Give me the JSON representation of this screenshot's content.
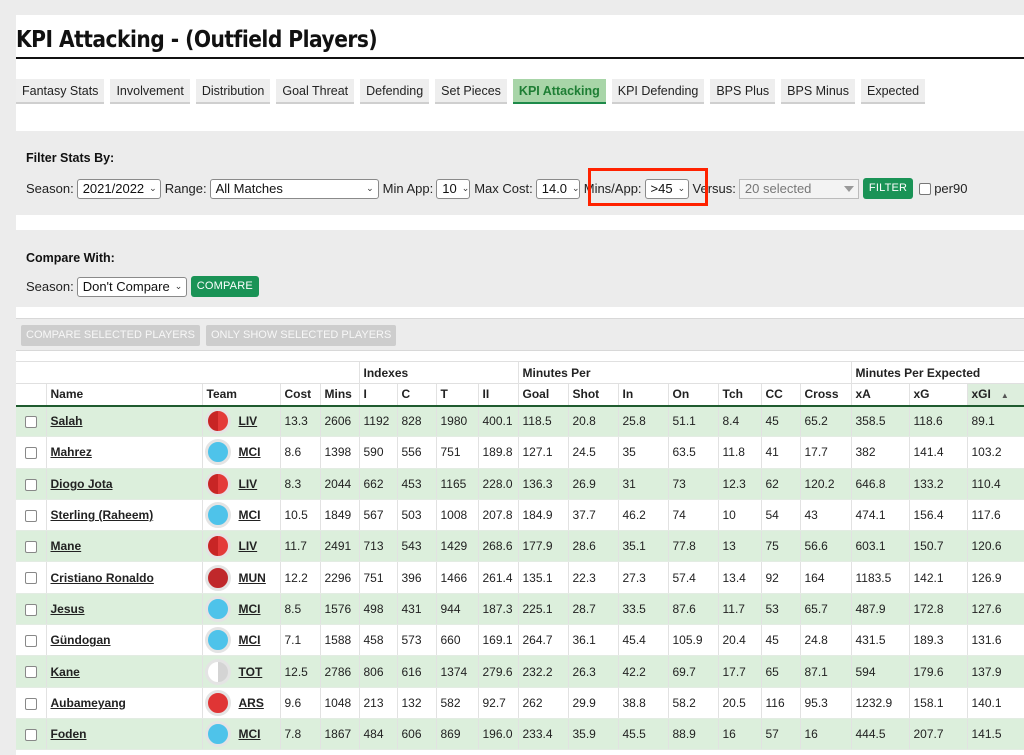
{
  "header": {
    "title": "KPI Attacking - (Outfield Players)"
  },
  "tabs": [
    {
      "label": "Fantasy Stats",
      "active": false
    },
    {
      "label": "Involvement",
      "active": false
    },
    {
      "label": "Distribution",
      "active": false
    },
    {
      "label": "Goal Threat",
      "active": false
    },
    {
      "label": "Defending",
      "active": false
    },
    {
      "label": "Set Pieces",
      "active": false
    },
    {
      "label": "KPI Attacking",
      "active": true
    },
    {
      "label": "KPI Defending",
      "active": false
    },
    {
      "label": "BPS Plus",
      "active": false
    },
    {
      "label": "BPS Minus",
      "active": false
    },
    {
      "label": "Expected",
      "active": false
    }
  ],
  "filter": {
    "title": "Filter Stats By:",
    "season_label": "Season:",
    "season_value": "2021/2022",
    "range_label": "Range:",
    "range_value": "All Matches",
    "min_app_label": "Min App:",
    "min_app_value": "10",
    "max_cost_label": "Max Cost:",
    "max_cost_value": "14.0",
    "mins_app_label": "Mins/App:",
    "mins_app_value": ">45",
    "versus_label": "Versus:",
    "versus_value": "20 selected",
    "filter_button": "FILTER",
    "per90_label": "per90"
  },
  "compare": {
    "title": "Compare With:",
    "season_label": "Season:",
    "season_value": "Don't Compare",
    "compare_button": "COMPARE"
  },
  "actions": {
    "compare_selected": "COMPARE SELECTED PLAYERS",
    "only_show_selected": "ONLY SHOW SELECTED PLAYERS"
  },
  "table": {
    "groups": {
      "indexes": "Indexes",
      "minutes_per": "Minutes Per",
      "minutes_per_expected": "Minutes Per Expected"
    },
    "columns": [
      "Name",
      "Team",
      "Cost",
      "Mins",
      "I",
      "C",
      "T",
      "II",
      "Goal",
      "Shot",
      "In",
      "On",
      "Tch",
      "CC",
      "Cross",
      "xA",
      "xG",
      "xGI"
    ],
    "sort_indicator": "▲",
    "team_colors": {
      "LIV": "#d42d2d",
      "MCI": "#4ec3ea",
      "MUN": "#c0282b",
      "TOT": "#ffffff",
      "ARS": "#e03535"
    },
    "rows": [
      {
        "name": "Salah",
        "team": "LIV",
        "cost": "13.3",
        "mins": "2606",
        "i": "1192",
        "c": "828",
        "t": "1980",
        "ii": "400.1",
        "goal": "118.5",
        "shot": "20.8",
        "in": "25.8",
        "on": "51.1",
        "tch": "8.4",
        "cc": "45",
        "cross": "65.2",
        "xa": "358.5",
        "xg": "118.6",
        "xgi": "89.1"
      },
      {
        "name": "Mahrez",
        "team": "MCI",
        "cost": "8.6",
        "mins": "1398",
        "i": "590",
        "c": "556",
        "t": "751",
        "ii": "189.8",
        "goal": "127.1",
        "shot": "24.5",
        "in": "35",
        "on": "63.5",
        "tch": "11.8",
        "cc": "41",
        "cross": "17.7",
        "xa": "382",
        "xg": "141.4",
        "xgi": "103.2"
      },
      {
        "name": "Diogo Jota",
        "team": "LIV",
        "cost": "8.3",
        "mins": "2044",
        "i": "662",
        "c": "453",
        "t": "1165",
        "ii": "228.0",
        "goal": "136.3",
        "shot": "26.9",
        "in": "31",
        "on": "73",
        "tch": "12.3",
        "cc": "62",
        "cross": "120.2",
        "xa": "646.8",
        "xg": "133.2",
        "xgi": "110.4"
      },
      {
        "name": "Sterling (Raheem)",
        "team": "MCI",
        "cost": "10.5",
        "mins": "1849",
        "i": "567",
        "c": "503",
        "t": "1008",
        "ii": "207.8",
        "goal": "184.9",
        "shot": "37.7",
        "in": "46.2",
        "on": "74",
        "tch": "10",
        "cc": "54",
        "cross": "43",
        "xa": "474.1",
        "xg": "156.4",
        "xgi": "117.6"
      },
      {
        "name": "Mane",
        "team": "LIV",
        "cost": "11.7",
        "mins": "2491",
        "i": "713",
        "c": "543",
        "t": "1429",
        "ii": "268.6",
        "goal": "177.9",
        "shot": "28.6",
        "in": "35.1",
        "on": "77.8",
        "tch": "13",
        "cc": "75",
        "cross": "56.6",
        "xa": "603.1",
        "xg": "150.7",
        "xgi": "120.6"
      },
      {
        "name": "Cristiano Ronaldo",
        "team": "MUN",
        "cost": "12.2",
        "mins": "2296",
        "i": "751",
        "c": "396",
        "t": "1466",
        "ii": "261.4",
        "goal": "135.1",
        "shot": "22.3",
        "in": "27.3",
        "on": "57.4",
        "tch": "13.4",
        "cc": "92",
        "cross": "164",
        "xa": "1183.5",
        "xg": "142.1",
        "xgi": "126.9"
      },
      {
        "name": "Jesus",
        "team": "MCI",
        "cost": "8.5",
        "mins": "1576",
        "i": "498",
        "c": "431",
        "t": "944",
        "ii": "187.3",
        "goal": "225.1",
        "shot": "28.7",
        "in": "33.5",
        "on": "87.6",
        "tch": "11.7",
        "cc": "53",
        "cross": "65.7",
        "xa": "487.9",
        "xg": "172.8",
        "xgi": "127.6"
      },
      {
        "name": "Gündogan",
        "team": "MCI",
        "cost": "7.1",
        "mins": "1588",
        "i": "458",
        "c": "573",
        "t": "660",
        "ii": "169.1",
        "goal": "264.7",
        "shot": "36.1",
        "in": "45.4",
        "on": "105.9",
        "tch": "20.4",
        "cc": "45",
        "cross": "24.8",
        "xa": "431.5",
        "xg": "189.3",
        "xgi": "131.6"
      },
      {
        "name": "Kane",
        "team": "TOT",
        "cost": "12.5",
        "mins": "2786",
        "i": "806",
        "c": "616",
        "t": "1374",
        "ii": "279.6",
        "goal": "232.2",
        "shot": "26.3",
        "in": "42.2",
        "on": "69.7",
        "tch": "17.7",
        "cc": "65",
        "cross": "87.1",
        "xa": "594",
        "xg": "179.6",
        "xgi": "137.9"
      },
      {
        "name": "Aubameyang",
        "team": "ARS",
        "cost": "9.6",
        "mins": "1048",
        "i": "213",
        "c": "132",
        "t": "582",
        "ii": "92.7",
        "goal": "262",
        "shot": "29.9",
        "in": "38.8",
        "on": "58.2",
        "tch": "20.5",
        "cc": "116",
        "cross": "95.3",
        "xa": "1232.9",
        "xg": "158.1",
        "xgi": "140.1"
      },
      {
        "name": "Foden",
        "team": "MCI",
        "cost": "7.8",
        "mins": "1867",
        "i": "484",
        "c": "606",
        "t": "869",
        "ii": "196.0",
        "goal": "233.4",
        "shot": "35.9",
        "in": "45.5",
        "on": "88.9",
        "tch": "16",
        "cc": "57",
        "cross": "16",
        "xa": "444.5",
        "xg": "207.7",
        "xgi": "141.5"
      }
    ]
  }
}
